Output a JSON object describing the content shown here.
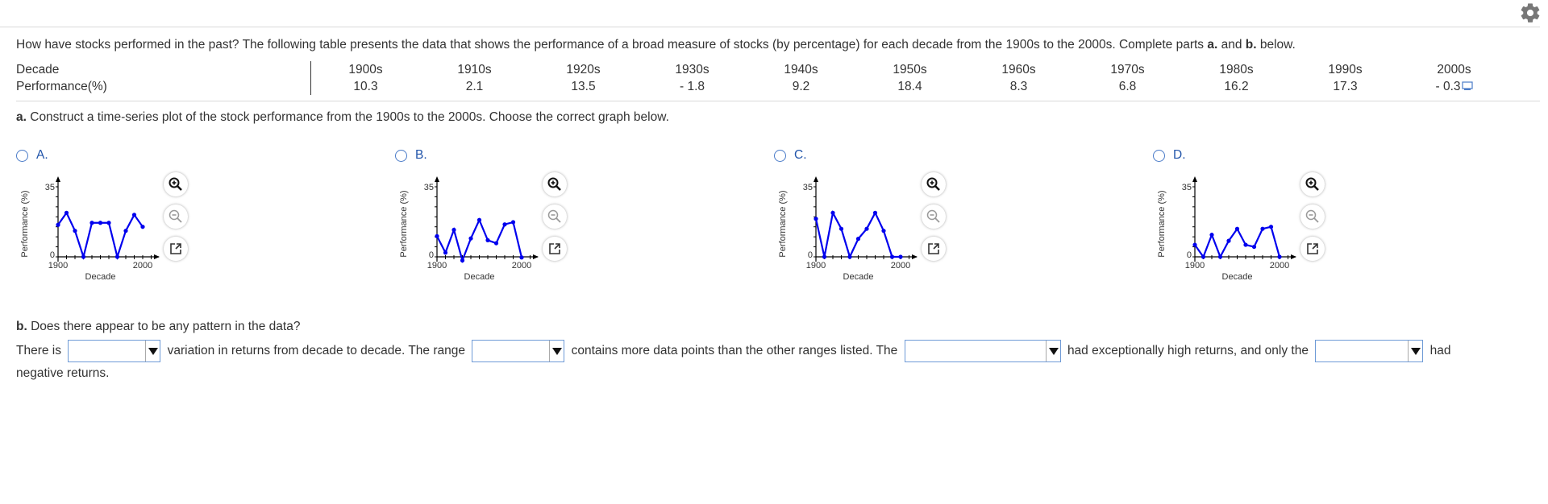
{
  "question": {
    "intro": "How have stocks performed in the past? The following table presents the data that shows the performance of a broad measure of stocks (by percentage) for each decade from the 1900s to the 2000s. Complete parts ",
    "bold_a": "a.",
    "and_text": " and ",
    "bold_b": "b.",
    "end": " below."
  },
  "table": {
    "row1_label": "Decade",
    "row2_label": "Performance(%)",
    "decades": [
      "1900s",
      "1910s",
      "1920s",
      "1930s",
      "1940s",
      "1950s",
      "1960s",
      "1970s",
      "1980s",
      "1990s",
      "2000s"
    ],
    "performance": [
      "10.3",
      "2.1",
      "13.5",
      "- 1.8",
      "9.2",
      "18.4",
      "8.3",
      "6.8",
      "16.2",
      "17.3",
      "- 0.3"
    ]
  },
  "part_a": {
    "bold": "a.",
    "text": " Construct a time-series plot of the stock performance from the 1900s to the 2000s. Choose the correct graph below."
  },
  "options": [
    {
      "label": "A.",
      "y_tick_top": "35",
      "y_tick_zero": "0",
      "x_start": "1900",
      "x_end": "2000",
      "ylabel": "Performance (%)",
      "xlabel": "Decade"
    },
    {
      "label": "B.",
      "y_tick_top": "35",
      "y_tick_zero": "0",
      "x_start": "1900",
      "x_end": "2000",
      "ylabel": "Performance (%)",
      "xlabel": "Decade"
    },
    {
      "label": "C.",
      "y_tick_top": "35",
      "y_tick_zero": "0",
      "x_start": "1900",
      "x_end": "2000",
      "ylabel": "Performance (%)",
      "xlabel": "Decade"
    },
    {
      "label": "D.",
      "y_tick_top": "35",
      "y_tick_zero": "0",
      "x_start": "1900",
      "x_end": "2000",
      "ylabel": "Performance (%)",
      "xlabel": "Decade"
    }
  ],
  "chart_data": [
    {
      "type": "line",
      "x": [
        1900,
        1910,
        1920,
        1930,
        1940,
        1950,
        1960,
        1970,
        1980,
        1990,
        2000
      ],
      "values": [
        16,
        22,
        13,
        0,
        17,
        17,
        17,
        0,
        13,
        21,
        15
      ],
      "ylim": [
        0,
        35
      ],
      "xlabel": "Decade",
      "ylabel": "Performance (%)",
      "color": "#0000ee"
    },
    {
      "type": "line",
      "x": [
        1900,
        1910,
        1920,
        1930,
        1940,
        1950,
        1960,
        1970,
        1980,
        1990,
        2000
      ],
      "values": [
        10.3,
        2.1,
        13.5,
        -1.8,
        9.2,
        18.4,
        8.3,
        6.8,
        16.2,
        17.3,
        -0.3
      ],
      "ylim": [
        0,
        35
      ],
      "xlabel": "Decade",
      "ylabel": "Performance (%)",
      "color": "#0000ee"
    },
    {
      "type": "line",
      "x": [
        1900,
        1910,
        1920,
        1930,
        1940,
        1950,
        1960,
        1970,
        1980,
        1990,
        2000
      ],
      "values": [
        19,
        0,
        22,
        14,
        0,
        9,
        14,
        22,
        13,
        0,
        0
      ],
      "ylim": [
        0,
        35
      ],
      "xlabel": "Decade",
      "ylabel": "Performance (%)",
      "color": "#0000ee"
    },
    {
      "type": "line",
      "x": [
        1900,
        1910,
        1920,
        1930,
        1940,
        1950,
        1960,
        1970,
        1980,
        1990,
        2000
      ],
      "values": [
        6,
        0,
        11,
        0,
        8,
        14,
        6,
        5,
        14,
        15,
        0
      ],
      "ylim": [
        0,
        35
      ],
      "xlabel": "Decade",
      "ylabel": "Performance (%)",
      "color": "#0000ee"
    }
  ],
  "part_b": {
    "bold": "b.",
    "text": " Does there appear to be any pattern in the data?"
  },
  "fill": {
    "t1": "There is",
    "t2": "variation in returns from decade to decade. The range",
    "t3": "contains more data points than the other ranges listed. The",
    "t4": "had exceptionally high returns, and only the",
    "t5": "had",
    "t6": "negative returns."
  },
  "colors": {
    "accent": "#2255aa",
    "line": "#0000ee"
  },
  "icons": [
    "gear-icon",
    "zoom-in-icon",
    "zoom-out-icon",
    "popout-icon"
  ]
}
